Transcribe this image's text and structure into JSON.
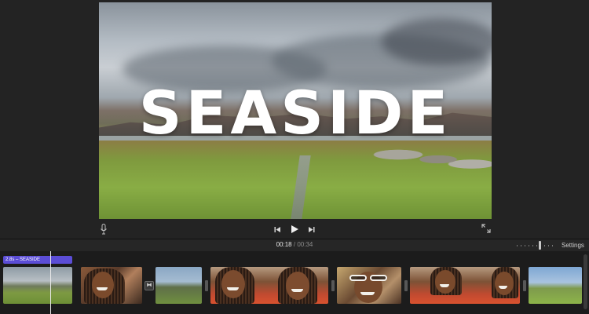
{
  "viewer": {
    "title_overlay": "SEASIDE"
  },
  "timecode": {
    "current": "00:18",
    "separator": "/",
    "total": "00:34"
  },
  "timeline": {
    "settings_label": "Settings",
    "title_clip_label": "2.8s – SEASIDE",
    "transition_icon": "bowtie-transition-icon"
  },
  "colors": {
    "title_bar": "#5b4dd6",
    "background": "#1e1e1e"
  }
}
